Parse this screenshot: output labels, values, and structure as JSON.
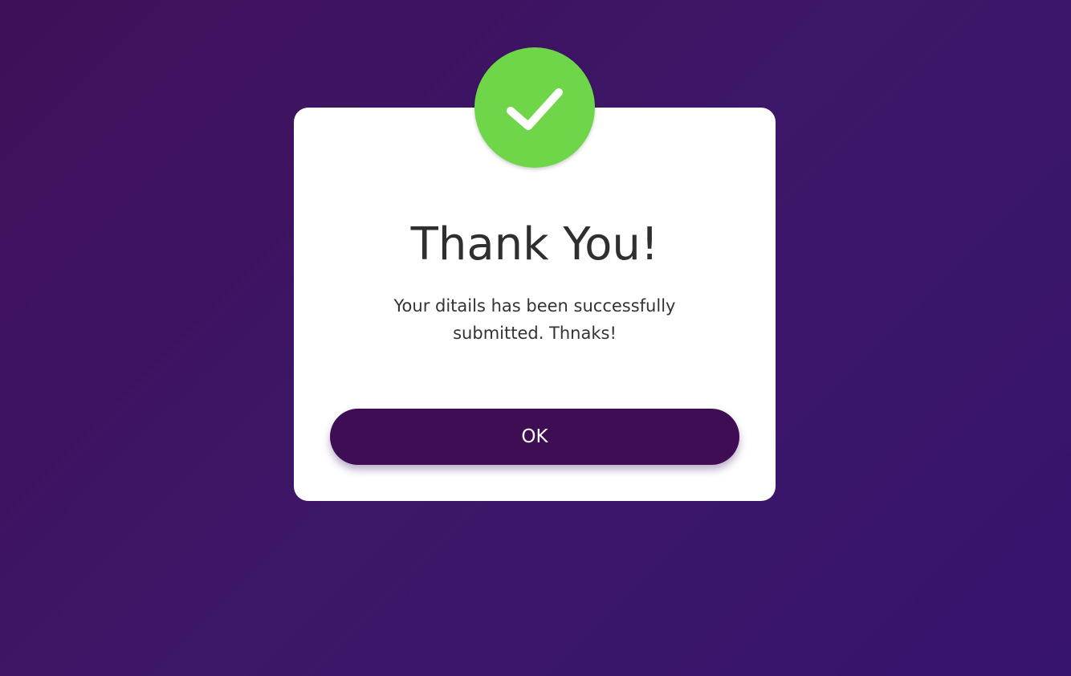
{
  "popup": {
    "title": "Thank You!",
    "message": "Your ditails has been successfully submitted. Thnaks!",
    "ok_label": "OK",
    "icon": "check-icon"
  },
  "colors": {
    "background": "#3d1769",
    "card": "#ffffff",
    "success": "#6fd649",
    "button": "#3f0d54",
    "text": "#2f2f2f"
  }
}
